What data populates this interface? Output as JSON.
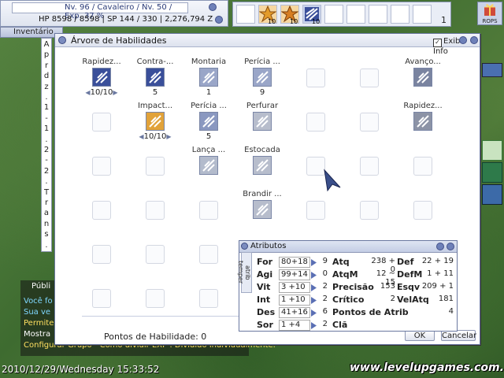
{
  "status": {
    "line1": "Nv. 96 / Cavaleiro / Nv. 50 / Exp. 37 %",
    "line2": "HP  8598 / 8598  |  SP  144 / 330  |  2,276,794 Z"
  },
  "hotbar": {
    "counts": [
      "10",
      "10",
      "10"
    ],
    "page": "1"
  },
  "rops_label": "ROPS",
  "inventory": {
    "title": "Inventário",
    "vertical_text": [
      "A",
      "p",
      "r",
      "d",
      "z",
      ".",
      "1",
      "-",
      "1",
      ".",
      "2",
      "-",
      "2",
      ".",
      "T",
      "r",
      "a",
      "n",
      "s",
      "."
    ]
  },
  "chat": {
    "tab": "Públi",
    "lines": [
      {
        "text": "Você fo",
        "color": "#7fd7ff"
      },
      {
        "text": "Sua ve",
        "color": "#7fd7ff"
      },
      {
        "text": "Permite",
        "color": "#ffe060"
      },
      {
        "text": "Mostra",
        "color": "#ffffff"
      },
      {
        "text": "Configurar Grupo - Como dividir EXP : Dividido individualmente.",
        "color": "#ffe060"
      }
    ]
  },
  "skill_window": {
    "title": "Árvore de Habilidades",
    "exibir_info": "Exibir Info",
    "skill_points_label": "Pontos de Habilidade: 0",
    "ok": "OK",
    "cancel": "Cancelar",
    "skills": [
      {
        "name": "Rapidez...",
        "level": "10/10",
        "icon": "two-hand-quicken-icon",
        "arrows": true
      },
      {
        "name": "Contra-...",
        "level": "5",
        "icon": "counter-attack-icon",
        "arrows": false
      },
      {
        "name": "Montaria",
        "level": "1",
        "icon": "riding-icon",
        "arrows": false
      },
      {
        "name": "Perícia ...",
        "level": "9",
        "icon": "spear-mastery-icon",
        "arrows": false
      },
      {
        "name": "Avanço...",
        "level": "",
        "icon": "charge-attack-icon",
        "arrows": false
      },
      {
        "name": "Impact...",
        "level": "10/10",
        "icon": "auto-counter-icon",
        "arrows": true
      },
      {
        "name": "Perícia ...",
        "level": "5",
        "icon": "cavalry-mastery-icon",
        "arrows": false
      },
      {
        "name": "Perfurar",
        "level": "",
        "icon": "pierce-icon",
        "arrows": false
      },
      {
        "name": "Rapidez...",
        "level": "",
        "icon": "spear-quicken-icon",
        "arrows": false
      },
      {
        "name": "Lança ...",
        "level": "",
        "icon": "spear-boomerang-icon",
        "arrows": false
      },
      {
        "name": "Estocada",
        "level": "",
        "icon": "spear-stab-icon",
        "arrows": false
      },
      {
        "name": "Brandir ...",
        "level": "",
        "icon": "brandish-spear-icon",
        "arrows": false
      }
    ]
  },
  "attributes": {
    "title": "Atributos",
    "tabs": "atrib  temper",
    "rows": [
      {
        "stat": "For",
        "value": "80+18",
        "cost": "9",
        "lname": "Atq",
        "lval": "238 + 0",
        "rname": "Def",
        "rval": "22 + 19"
      },
      {
        "stat": "Agi",
        "value": "99+14",
        "cost": "0",
        "lname": "AtqM",
        "lval": "12 ~ 15",
        "rname": "DefM",
        "rval": "1 + 11"
      },
      {
        "stat": "Vit",
        "value": "3 +10",
        "cost": "2",
        "lname": "Precisão",
        "lval": "153",
        "rname": "Esqv",
        "rval": "209 + 1"
      },
      {
        "stat": "Int",
        "value": "1 +10",
        "cost": "2",
        "lname": "Crítico",
        "lval": "2",
        "rname": "VelAtq",
        "rval": "181"
      },
      {
        "stat": "Des",
        "value": "41+16",
        "cost": "6",
        "lname": "Pontos de Atrib",
        "lval": "",
        "rname": "",
        "rval": "4"
      },
      {
        "stat": "Sor",
        "value": "1 +4",
        "cost": "2",
        "lname": "Clã",
        "lval": "",
        "rname": "",
        "rval": ""
      }
    ]
  },
  "clock": "2010/12/29/Wednesday  15:33:52",
  "watermark": "www.levelupgames.com.br"
}
